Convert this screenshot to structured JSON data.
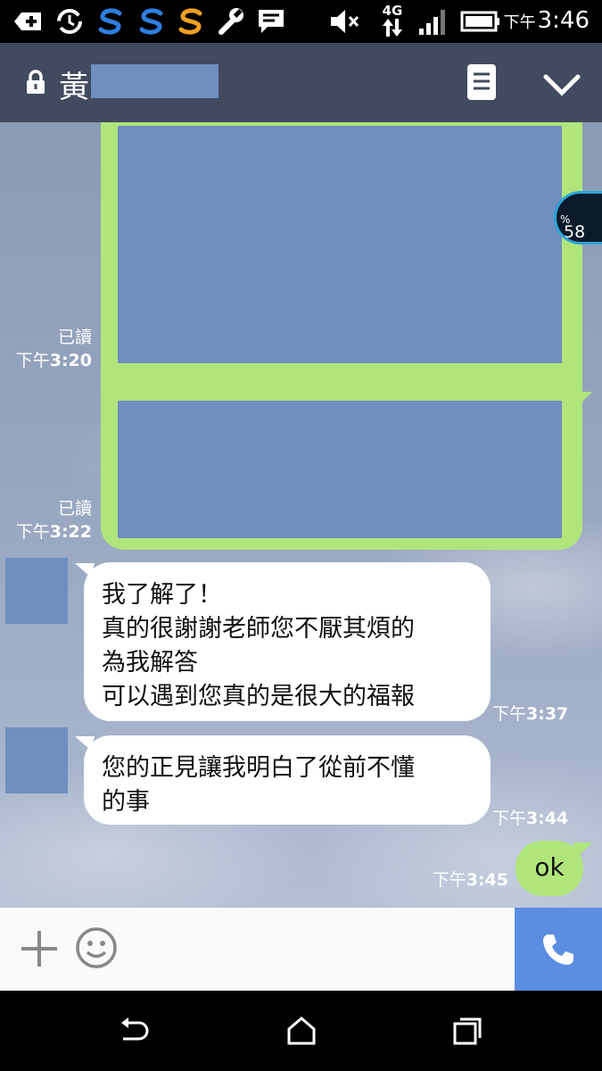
{
  "status_bar": {
    "ampm": "下午",
    "time": "3:46",
    "network": "4G",
    "icons": [
      "add-icon",
      "sync-icon",
      "s-app-icon",
      "s-app-icon",
      "s-app-icon",
      "wrench-icon",
      "message-icon",
      "mute-icon",
      "signal-icon",
      "battery-icon"
    ]
  },
  "header": {
    "title_char": "黃",
    "icons": [
      "lock-icon",
      "notes-icon",
      "chevron-down-icon"
    ]
  },
  "overlay": {
    "value": "58",
    "unit": "%"
  },
  "messages": [
    {
      "read": "已讀",
      "ampm": "下午",
      "time": "3:20"
    },
    {
      "read": "已讀",
      "ampm": "下午",
      "time": "3:22"
    },
    {
      "text": "我了解了！\n真的很謝謝老師您不厭其煩的\n為我解答\n可以遇到您真的是很大的福報",
      "ampm": "下午",
      "time": "3:37"
    },
    {
      "text": "您的正見讓我明白了從前不懂\n的事",
      "ampm": "下午",
      "time": "3:44"
    },
    {
      "text": "ok",
      "ampm": "下午",
      "time": "3:45"
    }
  ],
  "input_bar": {
    "icons": [
      "plus-icon",
      "emoji-icon",
      "phone-icon"
    ]
  },
  "nav_bar": {
    "icons": [
      "back-icon",
      "home-icon",
      "recents-icon"
    ]
  },
  "colors": {
    "header": "#414a5e",
    "bubble_out": "#b0e57c",
    "bubble_in": "#ffffff",
    "call": "#5b8de0",
    "redaction": "#6e8fc0"
  }
}
